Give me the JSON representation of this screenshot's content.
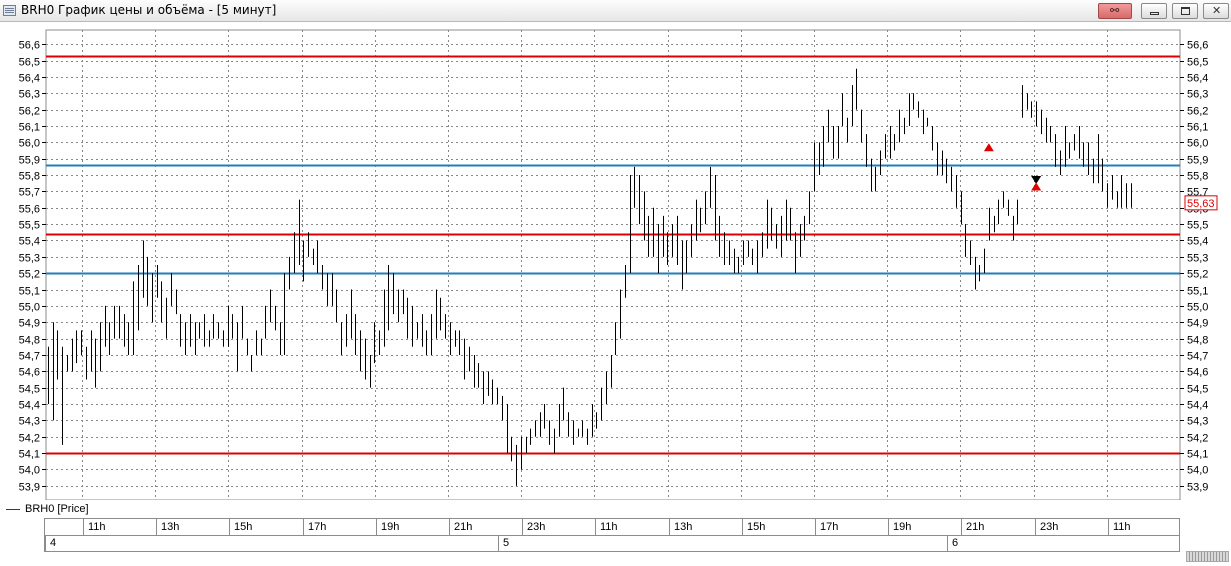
{
  "window": {
    "title": "BRH0 График цены и объёма - [5 минут]",
    "icon": "chart-window-icon",
    "buttons": [
      "link-icon",
      "minimize-icon",
      "restore-icon",
      "close-icon"
    ]
  },
  "legend": {
    "label": "BRH0 [Price]",
    "color": "#c00000"
  },
  "colors": {
    "price": "#000000",
    "hline_red": "#dd0000",
    "hline_blue": "#1f7fb8",
    "last_price_box": "#dd0000",
    "grid": "#888888"
  },
  "chart_data": {
    "type": "bar",
    "subtype": "ohlc-price",
    "ylim": [
      53.85,
      56.65
    ],
    "y_ticks": [
      "53,9",
      "54,0",
      "54,1",
      "54,2",
      "54,3",
      "54,4",
      "54,5",
      "54,6",
      "54,7",
      "54,8",
      "54,9",
      "55,0",
      "55,1",
      "55,2",
      "55,3",
      "55,4",
      "55,5",
      "55,6",
      "55,7",
      "55,8",
      "55,9",
      "56,0",
      "56,1",
      "56,2",
      "56,3",
      "56,4",
      "56,5",
      "56,6"
    ],
    "last_price": "55,63",
    "last_price_value": 55.63,
    "horizontal_lines": [
      {
        "value": 56.53,
        "color": "red"
      },
      {
        "value": 55.86,
        "color": "blue"
      },
      {
        "value": 55.44,
        "color": "red"
      },
      {
        "value": 55.2,
        "color": "blue"
      },
      {
        "value": 54.1,
        "color": "red"
      }
    ],
    "grid": true,
    "time_ticks": [
      "11h",
      "13h",
      "15h",
      "17h",
      "19h",
      "21h",
      "23h",
      "11h",
      "13h",
      "15h",
      "17h",
      "19h",
      "21h",
      "23h",
      "11h"
    ],
    "days": [
      "4",
      "5",
      "6"
    ],
    "x_range": [
      0,
      239
    ],
    "series": [
      {
        "color": "#000000",
        "bars": [
          [
            54.4,
            54.75
          ],
          [
            54.3,
            54.9
          ],
          [
            54.55,
            54.85
          ],
          [
            54.15,
            54.75
          ],
          [
            54.6,
            54.7
          ],
          [
            54.6,
            54.8
          ],
          [
            54.65,
            54.85
          ],
          [
            54.7,
            54.85
          ],
          [
            54.55,
            54.75
          ],
          [
            54.6,
            54.85
          ],
          [
            54.5,
            54.8
          ],
          [
            54.6,
            54.9
          ],
          [
            54.75,
            55.0
          ],
          [
            54.7,
            54.9
          ],
          [
            54.8,
            55.0
          ],
          [
            54.8,
            55.0
          ],
          [
            54.75,
            54.95
          ],
          [
            54.7,
            54.9
          ],
          [
            54.7,
            55.15
          ],
          [
            54.85,
            55.25
          ],
          [
            55.05,
            55.4
          ],
          [
            55.0,
            55.3
          ],
          [
            54.9,
            55.2
          ],
          [
            55.05,
            55.25
          ],
          [
            54.9,
            55.15
          ],
          [
            54.8,
            55.05
          ],
          [
            55.0,
            55.2
          ],
          [
            54.95,
            55.1
          ],
          [
            54.75,
            54.95
          ],
          [
            54.7,
            54.9
          ],
          [
            54.75,
            54.95
          ],
          [
            54.7,
            54.9
          ],
          [
            54.8,
            54.9
          ],
          [
            54.75,
            54.95
          ],
          [
            54.75,
            54.85
          ],
          [
            54.8,
            54.95
          ],
          [
            54.8,
            54.9
          ],
          [
            54.75,
            54.85
          ],
          [
            54.75,
            55.0
          ],
          [
            54.8,
            54.95
          ],
          [
            54.6,
            54.9
          ],
          [
            54.8,
            55.0
          ],
          [
            54.7,
            54.8
          ],
          [
            54.6,
            54.7
          ],
          [
            54.7,
            54.85
          ],
          [
            54.7,
            54.8
          ],
          [
            54.8,
            55.0
          ],
          [
            54.9,
            55.1
          ],
          [
            54.85,
            55.0
          ],
          [
            54.7,
            54.9
          ],
          [
            54.7,
            55.2
          ],
          [
            55.1,
            55.3
          ],
          [
            55.2,
            55.45
          ],
          [
            55.25,
            55.65
          ],
          [
            55.15,
            55.4
          ],
          [
            55.3,
            55.45
          ],
          [
            55.25,
            55.35
          ],
          [
            55.2,
            55.4
          ],
          [
            55.1,
            55.25
          ],
          [
            55.0,
            55.2
          ],
          [
            55.0,
            55.2
          ],
          [
            54.9,
            55.1
          ],
          [
            54.7,
            54.9
          ],
          [
            54.75,
            54.95
          ],
          [
            54.8,
            55.1
          ],
          [
            54.7,
            54.95
          ],
          [
            54.6,
            54.85
          ],
          [
            54.55,
            54.8
          ],
          [
            54.5,
            54.7
          ],
          [
            54.65,
            54.9
          ],
          [
            54.7,
            54.85
          ],
          [
            54.75,
            55.1
          ],
          [
            54.85,
            55.25
          ],
          [
            54.95,
            55.2
          ],
          [
            54.9,
            55.1
          ],
          [
            54.95,
            55.1
          ],
          [
            54.8,
            55.05
          ],
          [
            54.75,
            55.0
          ],
          [
            54.8,
            54.9
          ],
          [
            54.75,
            54.95
          ],
          [
            54.7,
            54.85
          ],
          [
            54.7,
            54.95
          ],
          [
            54.8,
            55.1
          ],
          [
            54.85,
            55.05
          ],
          [
            54.8,
            54.95
          ],
          [
            54.7,
            54.9
          ],
          [
            54.75,
            54.85
          ],
          [
            54.7,
            54.85
          ],
          [
            54.55,
            54.8
          ],
          [
            54.6,
            54.75
          ],
          [
            54.5,
            54.7
          ],
          [
            54.5,
            54.65
          ],
          [
            54.4,
            54.6
          ],
          [
            54.45,
            54.6
          ],
          [
            54.4,
            54.55
          ],
          [
            54.4,
            54.5
          ],
          [
            54.3,
            54.45
          ],
          [
            54.1,
            54.4
          ],
          [
            54.05,
            54.2
          ],
          [
            53.9,
            54.15
          ],
          [
            54.0,
            54.2
          ],
          [
            54.1,
            54.2
          ],
          [
            54.15,
            54.25
          ],
          [
            54.2,
            54.3
          ],
          [
            54.2,
            54.35
          ],
          [
            54.25,
            54.4
          ],
          [
            54.15,
            54.3
          ],
          [
            54.1,
            54.25
          ],
          [
            54.2,
            54.4
          ],
          [
            54.3,
            54.5
          ],
          [
            54.2,
            54.35
          ],
          [
            54.15,
            54.3
          ],
          [
            54.2,
            54.25
          ],
          [
            54.2,
            54.3
          ],
          [
            54.15,
            54.25
          ],
          [
            54.2,
            54.4
          ],
          [
            54.25,
            54.35
          ],
          [
            54.3,
            54.5
          ],
          [
            54.4,
            54.6
          ],
          [
            54.5,
            54.7
          ],
          [
            54.7,
            54.9
          ],
          [
            54.8,
            55.1
          ],
          [
            55.05,
            55.25
          ],
          [
            55.2,
            55.8
          ],
          [
            55.6,
            55.85
          ],
          [
            55.5,
            55.8
          ],
          [
            55.4,
            55.7
          ],
          [
            55.3,
            55.55
          ],
          [
            55.3,
            55.6
          ],
          [
            55.2,
            55.5
          ],
          [
            55.3,
            55.55
          ],
          [
            55.25,
            55.45
          ],
          [
            55.3,
            55.5
          ],
          [
            55.25,
            55.55
          ],
          [
            55.1,
            55.4
          ],
          [
            55.2,
            55.4
          ],
          [
            55.3,
            55.5
          ],
          [
            55.4,
            55.65
          ],
          [
            55.45,
            55.6
          ],
          [
            55.5,
            55.7
          ],
          [
            55.6,
            55.85
          ],
          [
            55.4,
            55.8
          ],
          [
            55.3,
            55.55
          ],
          [
            55.25,
            55.45
          ],
          [
            55.25,
            55.4
          ],
          [
            55.2,
            55.35
          ],
          [
            55.2,
            55.3
          ],
          [
            55.25,
            55.4
          ],
          [
            55.3,
            55.4
          ],
          [
            55.25,
            55.35
          ],
          [
            55.2,
            55.4
          ],
          [
            55.3,
            55.45
          ],
          [
            55.35,
            55.65
          ],
          [
            55.4,
            55.6
          ],
          [
            55.35,
            55.5
          ],
          [
            55.3,
            55.55
          ],
          [
            55.4,
            55.65
          ],
          [
            55.4,
            55.6
          ],
          [
            55.2,
            55.45
          ],
          [
            55.3,
            55.5
          ],
          [
            55.4,
            55.55
          ],
          [
            55.5,
            55.7
          ],
          [
            55.7,
            56.0
          ],
          [
            55.8,
            56.0
          ],
          [
            55.85,
            56.1
          ],
          [
            56.0,
            56.2
          ],
          [
            55.9,
            56.1
          ],
          [
            55.9,
            56.1
          ],
          [
            56.1,
            56.3
          ],
          [
            56.0,
            56.15
          ],
          [
            56.1,
            56.35
          ],
          [
            56.2,
            56.45
          ],
          [
            56.0,
            56.2
          ],
          [
            55.85,
            56.05
          ],
          [
            55.7,
            55.9
          ],
          [
            55.7,
            55.85
          ],
          [
            55.8,
            55.95
          ],
          [
            55.9,
            56.05
          ],
          [
            55.9,
            56.1
          ],
          [
            55.95,
            56.05
          ],
          [
            56.0,
            56.2
          ],
          [
            56.05,
            56.15
          ],
          [
            56.1,
            56.3
          ],
          [
            56.2,
            56.3
          ],
          [
            56.15,
            56.25
          ],
          [
            56.05,
            56.2
          ],
          [
            56.1,
            56.15
          ],
          [
            55.95,
            56.1
          ],
          [
            55.8,
            56.0
          ],
          [
            55.8,
            55.95
          ],
          [
            55.75,
            55.9
          ],
          [
            55.7,
            55.85
          ],
          [
            55.6,
            55.8
          ],
          [
            55.5,
            55.7
          ],
          [
            55.3,
            55.5
          ],
          [
            55.25,
            55.4
          ],
          [
            55.1,
            55.3
          ],
          [
            55.15,
            55.25
          ],
          [
            55.2,
            55.35
          ],
          [
            55.4,
            55.6
          ],
          [
            55.45,
            55.55
          ],
          [
            55.5,
            55.65
          ],
          [
            55.6,
            55.7
          ],
          [
            55.55,
            55.65
          ],
          [
            55.4,
            55.55
          ],
          [
            55.5,
            55.65
          ],
          [
            56.15,
            56.35
          ],
          [
            56.2,
            56.3
          ],
          [
            56.15,
            56.25
          ],
          [
            56.1,
            56.25
          ],
          [
            56.05,
            56.2
          ],
          [
            56.0,
            56.15
          ],
          [
            56.0,
            56.1
          ],
          [
            55.85,
            56.05
          ],
          [
            55.8,
            55.95
          ],
          [
            55.85,
            56.1
          ],
          [
            55.9,
            56.0
          ],
          [
            55.95,
            56.05
          ],
          [
            55.9,
            56.1
          ],
          [
            55.85,
            56.0
          ],
          [
            55.8,
            56.0
          ],
          [
            55.75,
            55.9
          ],
          [
            55.75,
            56.05
          ],
          [
            55.7,
            55.9
          ],
          [
            55.6,
            55.75
          ],
          [
            55.65,
            55.8
          ],
          [
            55.6,
            55.7
          ],
          [
            55.6,
            55.8
          ],
          [
            55.6,
            55.75
          ],
          [
            55.6,
            55.75
          ]
        ]
      }
    ],
    "markers": [
      {
        "x": 199,
        "y": 55.97,
        "type": "arrow-up",
        "color": "red"
      },
      {
        "x": 209,
        "y": 55.77,
        "type": "arrow-down",
        "color": "black"
      },
      {
        "x": 209,
        "y": 55.73,
        "type": "arrow-up",
        "color": "red"
      }
    ]
  }
}
